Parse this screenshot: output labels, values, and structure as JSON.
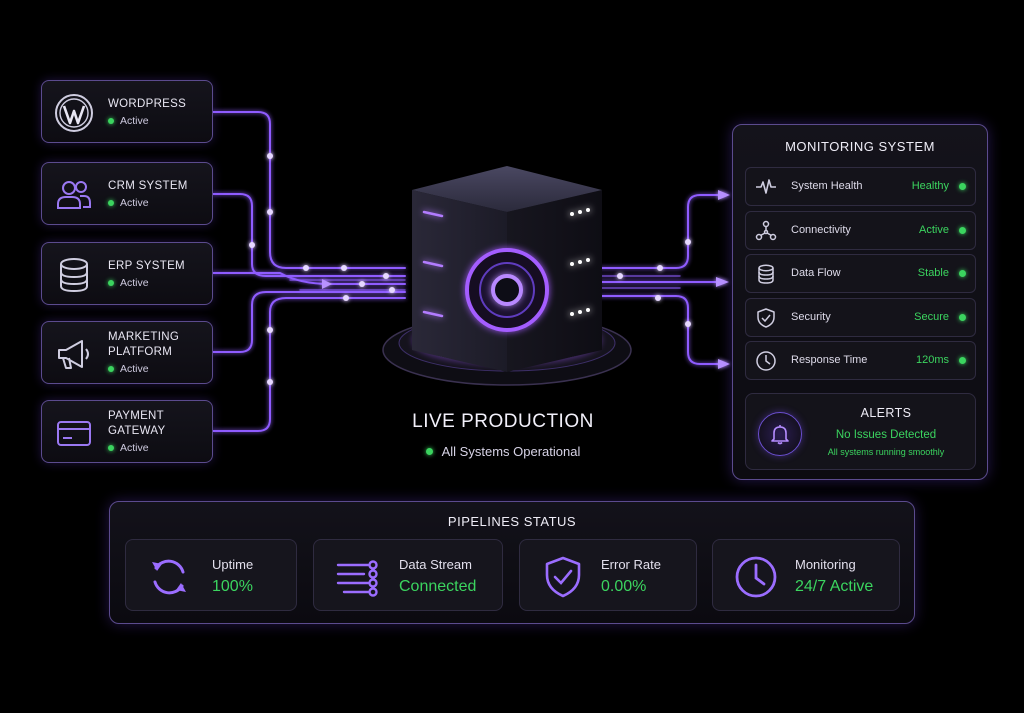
{
  "sources": [
    {
      "name": "WORDPRESS",
      "status": "Active",
      "icon": "wordpress-icon"
    },
    {
      "name": "CRM SYSTEM",
      "status": "Active",
      "icon": "users-icon"
    },
    {
      "name": "ERP SYSTEM",
      "status": "Active",
      "icon": "database-icon"
    },
    {
      "name": "MARKETING\nPLATFORM",
      "status": "Active",
      "icon": "megaphone-icon"
    },
    {
      "name": "PAYMENT\nGATEWAY",
      "status": "Active",
      "icon": "credit-card-icon"
    }
  ],
  "center": {
    "title": "LIVE PRODUCTION",
    "subtitle": "All Systems Operational",
    "icon": "server-stack-icon"
  },
  "monitoring": {
    "title": "MONITORING SYSTEM",
    "rows": [
      {
        "label": "System Health",
        "value": "Healthy",
        "icon": "heartbeat-icon"
      },
      {
        "label": "Connectivity",
        "value": "Active",
        "icon": "network-icon"
      },
      {
        "label": "Data Flow",
        "value": "Stable",
        "icon": "database-icon"
      },
      {
        "label": "Security",
        "value": "Secure",
        "icon": "shield-check-icon"
      },
      {
        "label": "Response Time",
        "value": "120ms",
        "icon": "clock-icon"
      }
    ],
    "alerts": {
      "title": "ALERTS",
      "main": "No Issues Detected",
      "sub": "All systems running smoothly",
      "icon": "bell-icon"
    }
  },
  "pipelines": {
    "title": "PIPELINES STATUS",
    "items": [
      {
        "label": "Uptime",
        "value": "100%",
        "icon": "refresh-icon"
      },
      {
        "label": "Data Stream",
        "value": "Connected",
        "icon": "stream-icon"
      },
      {
        "label": "Error Rate",
        "value": "0.00%",
        "icon": "shield-check-icon"
      },
      {
        "label": "Monitoring",
        "value": "24/7 Active",
        "icon": "clock-icon"
      }
    ]
  },
  "colors": {
    "accent": "#8b5cf6",
    "glow": "#a66bff",
    "status_green": "#3bd45f",
    "border": "#5b4b8e",
    "background": "#000000"
  }
}
